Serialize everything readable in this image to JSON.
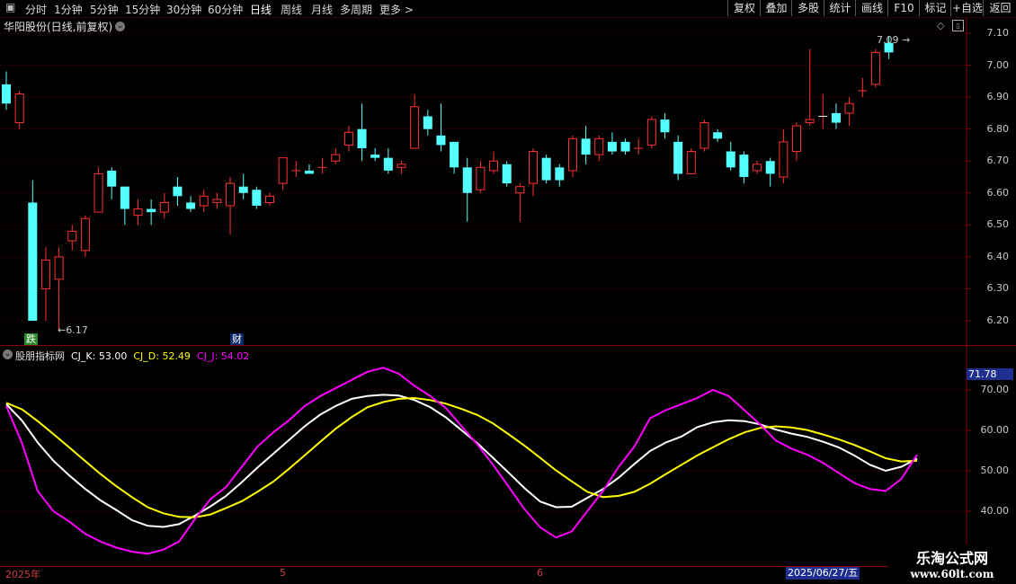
{
  "toolbar": {
    "periods": [
      "分时",
      "1分钟",
      "5分钟",
      "15分钟",
      "30分钟",
      "60分钟",
      "日线",
      "周线",
      "月线",
      "多周期",
      "更多 >"
    ],
    "active_period": "日线",
    "buttons": [
      "复权",
      "叠加",
      "多股",
      "统计",
      "画线",
      "F10",
      "标记",
      "+自选",
      "返回"
    ]
  },
  "main_chart": {
    "title": "华阳股份(日线,前复权)",
    "price_axis": [
      "7.10",
      "7.00",
      "6.90",
      "6.80",
      "6.70",
      "6.60",
      "6.50",
      "6.40",
      "6.30",
      "6.20"
    ],
    "high_label": "7.09",
    "low_label": "6.17",
    "badges": [
      {
        "text": "跌",
        "color": "#2a8a2a"
      },
      {
        "text": "财",
        "color": "#0b2a6a"
      }
    ]
  },
  "indicator": {
    "name": "股朋指标网",
    "k_label": "CJ_K: 53.00",
    "d_label": "CJ_D: 52.49",
    "j_label": "CJ_J: 54.02",
    "current_value": "71.78",
    "axis": [
      "70.00",
      "60.00",
      "50.00",
      "40.00"
    ]
  },
  "date_axis": {
    "labels": [
      "2025年",
      "5",
      "6"
    ],
    "cursor_date": "2025/06/27/五"
  },
  "watermark": {
    "line1": "乐淘公式网",
    "line2": "www.60lt.com"
  },
  "colors": {
    "up": "#ff3232",
    "down": "#54ffff",
    "k": "#ffffff",
    "d": "#ffff00",
    "j": "#ff00ff"
  },
  "chart_data": {
    "type": "candlestick",
    "price_range": [
      6.15,
      7.13
    ],
    "candles": [
      [
        6.94,
        6.88,
        6.98,
        6.86
      ],
      [
        6.82,
        6.91,
        6.92,
        6.8
      ],
      [
        6.57,
        6.2,
        6.64,
        6.2
      ],
      [
        6.3,
        6.39,
        6.43,
        6.2
      ],
      [
        6.33,
        6.4,
        6.43,
        6.17
      ],
      [
        6.45,
        6.48,
        6.5,
        6.42
      ],
      [
        6.42,
        6.52,
        6.53,
        6.4
      ],
      [
        6.54,
        6.66,
        6.68,
        6.54
      ],
      [
        6.67,
        6.62,
        6.68,
        6.58
      ],
      [
        6.62,
        6.55,
        6.62,
        6.5
      ],
      [
        6.53,
        6.55,
        6.58,
        6.5
      ],
      [
        6.55,
        6.54,
        6.58,
        6.5
      ],
      [
        6.54,
        6.57,
        6.6,
        6.52
      ],
      [
        6.62,
        6.59,
        6.65,
        6.56
      ],
      [
        6.57,
        6.55,
        6.59,
        6.54
      ],
      [
        6.56,
        6.59,
        6.61,
        6.54
      ],
      [
        6.57,
        6.58,
        6.6,
        6.55
      ],
      [
        6.56,
        6.63,
        6.65,
        6.47
      ],
      [
        6.62,
        6.6,
        6.66,
        6.58
      ],
      [
        6.61,
        6.56,
        6.62,
        6.55
      ],
      [
        6.57,
        6.59,
        6.6,
        6.56
      ],
      [
        6.63,
        6.71,
        6.71,
        6.61
      ],
      [
        6.67,
        6.67,
        6.7,
        6.65
      ],
      [
        6.67,
        6.66,
        6.69,
        6.66
      ],
      [
        6.68,
        6.68,
        6.71,
        6.66
      ],
      [
        6.7,
        6.72,
        6.74,
        6.69
      ],
      [
        6.75,
        6.79,
        6.81,
        6.73
      ],
      [
        6.8,
        6.74,
        6.88,
        6.7
      ],
      [
        6.72,
        6.71,
        6.74,
        6.7
      ],
      [
        6.71,
        6.67,
        6.74,
        6.66
      ],
      [
        6.68,
        6.69,
        6.7,
        6.66
      ],
      [
        6.74,
        6.87,
        6.91,
        6.74
      ],
      [
        6.84,
        6.8,
        6.86,
        6.78
      ],
      [
        6.78,
        6.75,
        6.88,
        6.73
      ],
      [
        6.76,
        6.68,
        6.76,
        6.66
      ],
      [
        6.68,
        6.6,
        6.71,
        6.51
      ],
      [
        6.61,
        6.68,
        6.7,
        6.6
      ],
      [
        6.67,
        6.7,
        6.73,
        6.66
      ],
      [
        6.69,
        6.63,
        6.7,
        6.62
      ],
      [
        6.6,
        6.62,
        6.63,
        6.51
      ],
      [
        6.63,
        6.73,
        6.74,
        6.59
      ],
      [
        6.71,
        6.64,
        6.72,
        6.63
      ],
      [
        6.68,
        6.64,
        6.69,
        6.62
      ],
      [
        6.67,
        6.77,
        6.78,
        6.65
      ],
      [
        6.77,
        6.72,
        6.81,
        6.69
      ],
      [
        6.72,
        6.77,
        6.78,
        6.7
      ],
      [
        6.76,
        6.73,
        6.79,
        6.72
      ],
      [
        6.76,
        6.73,
        6.77,
        6.72
      ],
      [
        6.74,
        6.74,
        6.77,
        6.72
      ],
      [
        6.75,
        6.83,
        6.84,
        6.74
      ],
      [
        6.83,
        6.79,
        6.85,
        6.77
      ],
      [
        6.76,
        6.66,
        6.78,
        6.64
      ],
      [
        6.66,
        6.73,
        6.74,
        6.66
      ],
      [
        6.74,
        6.82,
        6.83,
        6.73
      ],
      [
        6.79,
        6.77,
        6.8,
        6.76
      ],
      [
        6.73,
        6.68,
        6.76,
        6.67
      ],
      [
        6.72,
        6.65,
        6.73,
        6.63
      ],
      [
        6.67,
        6.69,
        6.7,
        6.66
      ],
      [
        6.7,
        6.66,
        6.71,
        6.62
      ],
      [
        6.65,
        6.76,
        6.8,
        6.63
      ],
      [
        6.73,
        6.81,
        6.82,
        6.7
      ],
      [
        6.82,
        6.83,
        7.05,
        6.81
      ],
      [
        6.84,
        6.84,
        6.91,
        6.8
      ],
      [
        6.85,
        6.82,
        6.88,
        6.8
      ],
      [
        6.85,
        6.88,
        6.9,
        6.81
      ],
      [
        6.92,
        6.92,
        6.96,
        6.9
      ],
      [
        6.94,
        7.04,
        7.05,
        6.93
      ],
      [
        7.07,
        7.04,
        7.09,
        7.02
      ]
    ],
    "indicator_range": [
      30,
      75
    ],
    "series": [
      {
        "name": "CJ_K",
        "values": [
          66.5,
          62.4,
          57,
          52.5,
          48.9,
          45.6,
          42.7,
          40.3,
          37.8,
          36.4,
          36.1,
          36.8,
          38.9,
          41.2,
          43.8,
          47.2,
          50.8,
          54.2,
          57.6,
          61,
          63.9,
          66.1,
          67.8,
          68.5,
          68.8,
          68.6,
          67.5,
          65.7,
          63.2,
          60,
          56.8,
          53.2,
          49.5,
          45.7,
          42.4,
          41,
          41.1,
          43.3,
          45.5,
          48.3,
          51.7,
          54.9,
          57,
          58.5,
          60.8,
          62,
          62.5,
          62.3,
          61.5,
          60.2,
          59.2,
          58.4,
          57.2,
          55.8,
          53.8,
          51.5,
          50,
          51,
          53
        ]
      },
      {
        "name": "CJ_D",
        "values": [
          66.8,
          65.2,
          62.3,
          59.1,
          55.8,
          52.5,
          49.2,
          46.2,
          43.5,
          41,
          39.5,
          38.6,
          38.5,
          39.2,
          40.8,
          42.5,
          44.8,
          47.3,
          50.5,
          53.8,
          57.2,
          60.5,
          63.3,
          65.7,
          67,
          67.8,
          68,
          67.5,
          66.6,
          65.3,
          63.8,
          61.7,
          59,
          56.2,
          53.2,
          50.1,
          47.4,
          44.8,
          43.5,
          43.8,
          44.8,
          46.8,
          49.2,
          51.5,
          53.8,
          55.8,
          57.8,
          59.5,
          60.6,
          61,
          60.7,
          60.1,
          59,
          57.8,
          56.4,
          54.8,
          53.1,
          52.3,
          52.5
        ]
      },
      {
        "name": "CJ_J",
        "values": [
          66,
          56.8,
          45,
          40,
          37.5,
          34.5,
          32.5,
          31,
          30,
          29.5,
          30.5,
          32.5,
          38,
          43,
          46,
          51,
          56,
          59.5,
          62.5,
          66,
          68.5,
          70.5,
          72.5,
          74.5,
          75.5,
          74,
          71,
          68.5,
          65.5,
          61,
          56.5,
          51.5,
          46,
          40.5,
          36,
          33.5,
          35,
          40,
          45,
          51,
          56,
          63,
          65,
          66.5,
          68,
          70,
          68.5,
          65,
          61.5,
          57.5,
          55.5,
          54,
          52,
          49.5,
          47,
          45.5,
          45,
          48,
          54
        ]
      }
    ]
  }
}
